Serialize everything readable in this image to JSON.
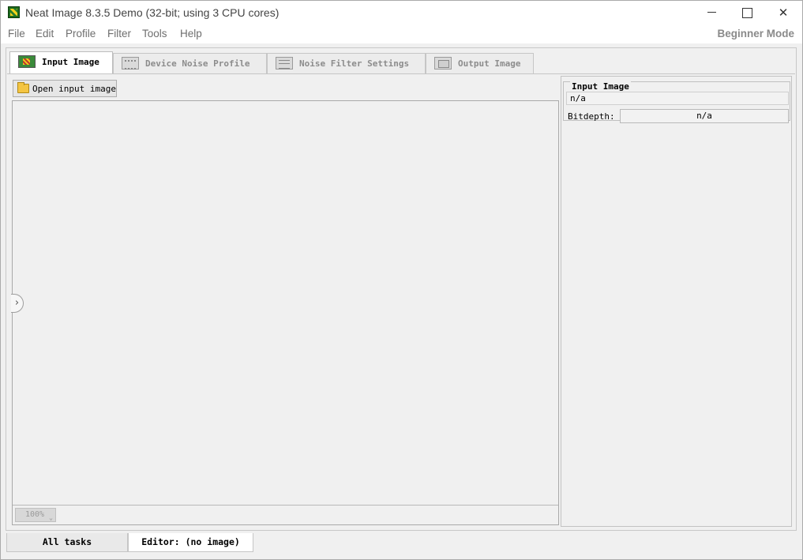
{
  "window": {
    "title": "Neat Image 8.3.5 Demo (32-bit; using 3 CPU cores)",
    "controls": {
      "minimize": "",
      "maximize": "",
      "close": "✕"
    }
  },
  "menu": {
    "items": [
      "File",
      "Edit",
      "Profile",
      "Filter",
      "Tools",
      "Help"
    ],
    "mode": "Beginner Mode"
  },
  "tabs": [
    {
      "label": "Input Image",
      "icon": "input-image-icon",
      "active": true
    },
    {
      "label": "Device Noise Profile",
      "icon": "noise-profile-icon",
      "active": false
    },
    {
      "label": "Noise Filter Settings",
      "icon": "filter-settings-icon",
      "active": false
    },
    {
      "label": "Output Image",
      "icon": "output-image-icon",
      "active": false
    }
  ],
  "toolbar": {
    "open_label": "Open input image"
  },
  "canvas": {
    "zoom": "100%",
    "zoom_caret": "⌄",
    "toggle": "›"
  },
  "info_panel": {
    "title": "Input Image",
    "filename": "n/a",
    "bitdepth_label": "Bitdepth:",
    "bitdepth_value": "n/a"
  },
  "bottom_tabs": [
    {
      "label": "All tasks",
      "active": false
    },
    {
      "label": "Editor: (no image)",
      "active": true
    }
  ]
}
